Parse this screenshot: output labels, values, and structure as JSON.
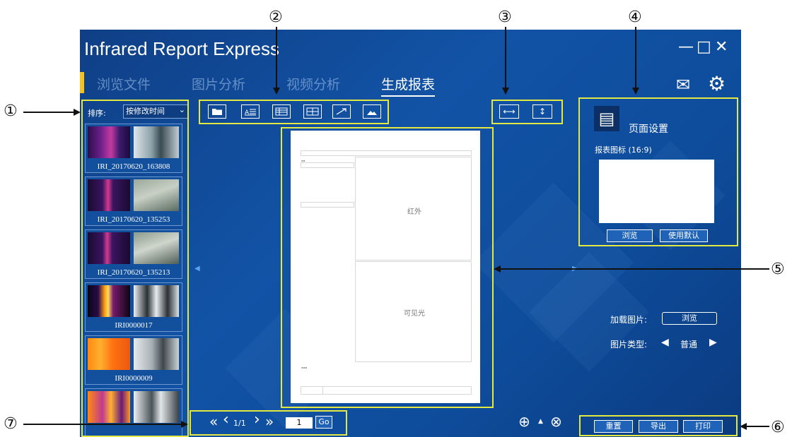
{
  "window": {
    "title": "Infrared Report Express",
    "minimize": "—",
    "maximize": "□",
    "close": "✕"
  },
  "tabs": [
    {
      "label": "浏览文件"
    },
    {
      "label": "图片分析"
    },
    {
      "label": "视频分析"
    },
    {
      "label": "生成报表"
    }
  ],
  "active_tab": 3,
  "header_icons": {
    "mail": "✉",
    "settings": "⚙"
  },
  "sidebar": {
    "sort_label": "排序:",
    "sort_value": "按修改时间",
    "sort_chevron": "⌄",
    "thumbnails": [
      {
        "caption": "IRI_20170620_163808"
      },
      {
        "caption": "IRI_20170620_135253"
      },
      {
        "caption": "IRI_20170620_135213"
      },
      {
        "caption": "IRI0000017"
      },
      {
        "caption": "IRI0000009"
      },
      {
        "caption": ""
      }
    ]
  },
  "toolbar_icons": [
    "folder-icon",
    "text-icon",
    "table-list-icon",
    "table-grid-icon",
    "arrow-line-icon",
    "image-icon"
  ],
  "fit_buttons": {
    "fit_width": "⟷",
    "fit_height": "↕"
  },
  "preview": {
    "infrared_label": "红外",
    "visible_label": "可见光"
  },
  "page_settings": {
    "doc_icon": "▤",
    "title": "页面设置",
    "report_icon_label": "报表图标 (16:9)",
    "browse": "浏览",
    "use_default": "使用默认",
    "load_image_label": "加载图片:",
    "load_browse": "浏览",
    "image_type_label": "图片类型:",
    "image_type_value": "普通",
    "left_arrow": "◀",
    "right_arrow": "▶"
  },
  "pager": {
    "first": "«",
    "prev": "‹",
    "page": "1/1",
    "next": "›",
    "last": "»",
    "input": "1",
    "go": "Go"
  },
  "zoom": {
    "in": "⊕",
    "up": "▲",
    "reset": "⊗"
  },
  "actions": {
    "reset": "重置",
    "export": "导出",
    "print": "打印"
  },
  "callouts": [
    "①",
    "②",
    "③",
    "④",
    "⑤",
    "⑥",
    "⑦"
  ],
  "colors": {
    "highlight": "#e3e843",
    "background": "#1253a6",
    "accent": "#f4c21a"
  }
}
